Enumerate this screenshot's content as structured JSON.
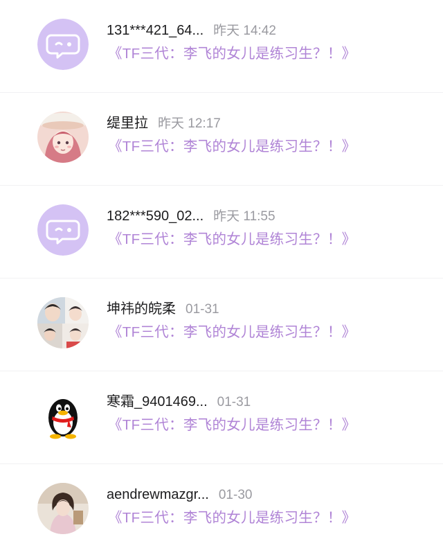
{
  "comments": [
    {
      "avatar": "default-chat-avatar-icon",
      "name": "131***421_64...",
      "time": "昨天 14:42",
      "book": "《TF三代：李飞的女儿是练习生？！》"
    },
    {
      "avatar": "anime-girl-avatar",
      "name": "缇里拉",
      "time": "昨天 12:17",
      "book": "《TF三代：李飞的女儿是练习生？！》"
    },
    {
      "avatar": "default-chat-avatar-icon",
      "name": "182***590_02...",
      "time": "昨天 11:55",
      "book": "《TF三代：李飞的女儿是练习生？！》"
    },
    {
      "avatar": "photo-collage-avatar",
      "name": "坤祎的皖柔",
      "time": "01-31",
      "book": "《TF三代：李飞的女儿是练习生？！》"
    },
    {
      "avatar": "qq-penguin-icon",
      "name": "寒霜_9401469...",
      "time": "01-31",
      "book": "《TF三代：李飞的女儿是练习生？！》"
    },
    {
      "avatar": "portrait-photo-avatar",
      "name": "aendrewmazgr...",
      "time": "01-30",
      "book": "《TF三代：李飞的女儿是练习生？！》"
    }
  ],
  "colors": {
    "accent": "#b084d6",
    "avatar_default_bg": "#d4c2f4",
    "name": "#1c1c1e",
    "time": "#9a9aa0"
  }
}
